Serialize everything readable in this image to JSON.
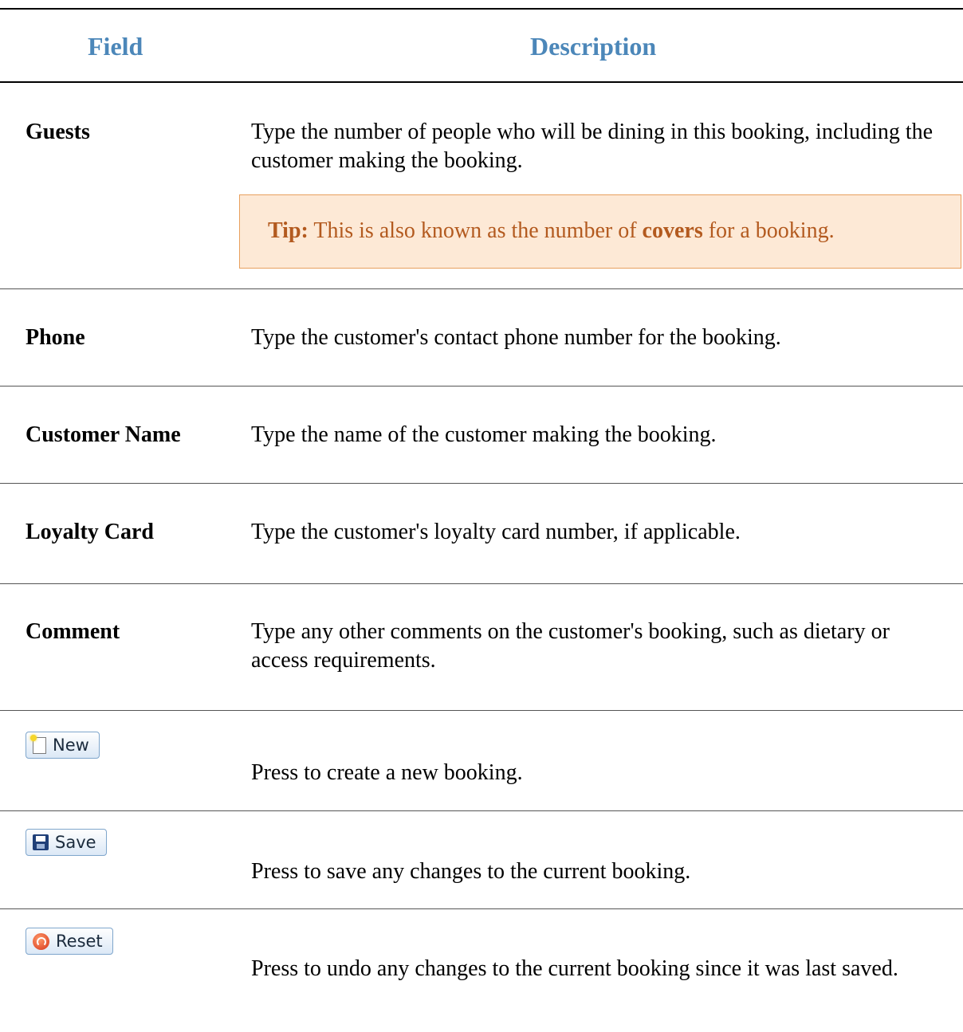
{
  "header": {
    "field": "Field",
    "description": "Description"
  },
  "rows": [
    {
      "field": "Guests",
      "description": "Type the number of people who will be dining in this booking, including the customer making the booking."
    },
    {
      "field": "Phone",
      "description": "Type the customer's contact phone number for the booking."
    },
    {
      "field": "Customer Name",
      "description": "Type the name of the customer making the booking."
    },
    {
      "field": "Loyalty Card",
      "description": "Type the customer's loyalty card number, if applicable."
    },
    {
      "field": "Comment",
      "description": "Type any other comments on the customer's booking, such as dietary or access requirements."
    }
  ],
  "tip": {
    "label": "Tip:",
    "text_before": "This is also known as the number of",
    "bold": "covers",
    "text_after": "for a booking."
  },
  "buttons": [
    {
      "label": "New",
      "icon": "new-document-icon",
      "description": "Press to create a new booking."
    },
    {
      "label": "Save",
      "icon": "floppy-disk-icon",
      "description": "Press to save any changes to the current booking."
    },
    {
      "label": "Reset",
      "icon": "reset-icon",
      "description": "Press to undo any changes to the current booking since it was last saved."
    }
  ],
  "colors": {
    "header": "#4c87b9",
    "tip_bg": "#fde9d6",
    "tip_border": "#e8a05e",
    "tip_text": "#b35a1f"
  }
}
